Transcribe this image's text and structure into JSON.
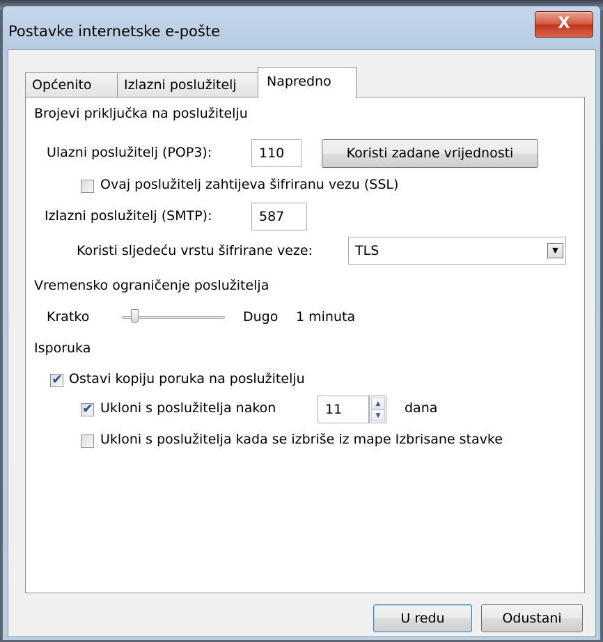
{
  "window": {
    "title": "Postavke internetske e-pošte",
    "close_label": "X"
  },
  "tabs": [
    {
      "label": "Općenito"
    },
    {
      "label": "Izlazni poslužitelj"
    },
    {
      "label": "Napredno"
    }
  ],
  "ports": {
    "group_title": "Brojevi priključka na poslužitelju",
    "incoming_label": "Ulazni poslužitelj (POP3):",
    "incoming_value": "110",
    "defaults_button": "Koristi zadane vrijednosti",
    "ssl_label": "Ovaj poslužitelj zahtijeva šifriranu vezu (SSL)",
    "ssl_checked": false,
    "outgoing_label": "Izlazni poslužitelj (SMTP):",
    "outgoing_value": "587",
    "encryption_label": "Koristi sljedeću vrstu šifrirane veze:",
    "encryption_value": "TLS"
  },
  "timeout": {
    "group_title": "Vremensko ograničenje poslužitelja",
    "short_label": "Kratko",
    "long_label": "Dugo",
    "value_label": "1 minuta",
    "slider_level": 0.12
  },
  "delivery": {
    "group_title": "Isporuka",
    "leave_copy_label": "Ostavi kopiju poruka na poslužitelju",
    "leave_copy_checked": true,
    "remove_after_label": "Ukloni s poslužitelja nakon",
    "remove_after_checked": true,
    "remove_after_days": "11",
    "days_label": "dana",
    "remove_deleted_label": "Ukloni s poslužitelja kada se izbriše iz mape Izbrisane stavke",
    "remove_deleted_checked": false
  },
  "footer": {
    "ok_label": "U redu",
    "cancel_label": "Odustani"
  }
}
